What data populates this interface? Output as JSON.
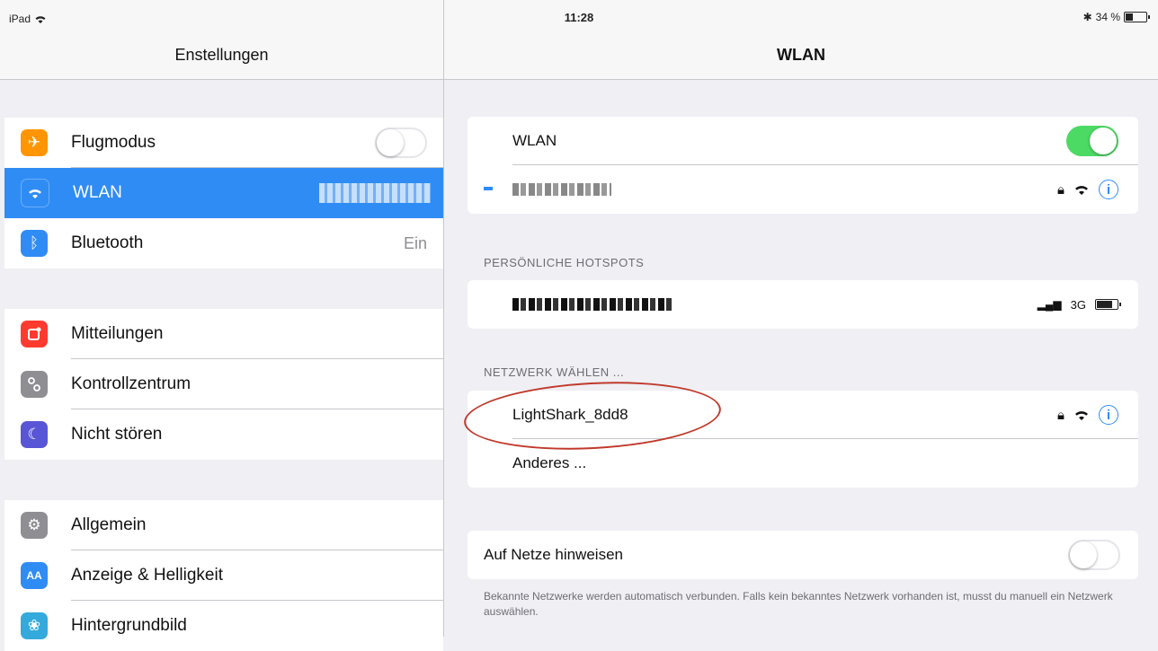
{
  "status": {
    "device": "iPad",
    "time": "11:28",
    "battery": "34 %",
    "battery_level": 0.34
  },
  "left_nav": {
    "title": "Enstellungen"
  },
  "right_nav": {
    "title": "WLAN"
  },
  "sidebar": {
    "group1": [
      {
        "label": "Flugmodus",
        "icon": "airplane-icon",
        "color": "#ff9500",
        "toggle": "off"
      },
      {
        "label": "WLAN",
        "icon": "wifi-icon",
        "color": "#2f8cf5",
        "selected": true
      },
      {
        "label": "Bluetooth",
        "icon": "bluetooth-icon",
        "color": "#2f8cf5",
        "value": "Ein"
      }
    ],
    "group2": [
      {
        "label": "Mitteilungen",
        "icon": "notifications-icon",
        "color": "#ff3b30"
      },
      {
        "label": "Kontrollzentrum",
        "icon": "control-center-icon",
        "color": "#8e8e93"
      },
      {
        "label": "Nicht stören",
        "icon": "moon-icon",
        "color": "#5856d6"
      }
    ],
    "group3": [
      {
        "label": "Allgemein",
        "icon": "gear-icon",
        "color": "#8e8e93"
      },
      {
        "label": "Anzeige & Helligkeit",
        "icon": "display-icon",
        "color": "#2f8cf5"
      },
      {
        "label": "Hintergrundbild",
        "icon": "wallpaper-icon",
        "color": "#34aadc"
      }
    ]
  },
  "wlan": {
    "toggle_label": "WLAN",
    "toggle_state": "on",
    "hotspots_header": "PERSÖNLICHE HOTSPOTS",
    "hotspot_signal": "3G",
    "networks_header": "NETZWERK WÄHLEN ...",
    "networks": [
      {
        "name": "LightShark_8dd8",
        "locked": true
      }
    ],
    "other_label": "Anderes ...",
    "ask_label": "Auf Netze hinweisen",
    "ask_state": "off",
    "ask_note": "Bekannte Netzwerke werden automatisch verbunden. Falls kein bekanntes Netzwerk vorhanden ist, musst du manuell ein Netzwerk auswählen."
  },
  "colors": {
    "accent": "#2f8cf5",
    "toggle_on": "#4cd964",
    "highlight_circle": "#c0392b"
  }
}
